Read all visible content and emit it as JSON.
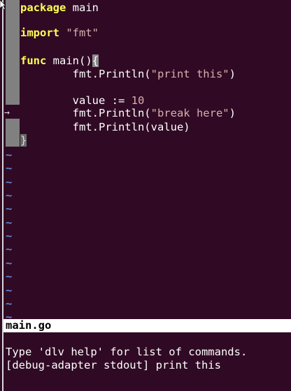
{
  "editor": {
    "lines": [
      {
        "kw": "package",
        "rest": " main"
      },
      {
        "empty": true
      },
      {
        "kw": "import",
        "space": " ",
        "str": "\"fmt\""
      },
      {
        "empty": true
      },
      {
        "kw": "func",
        "rest": " main()",
        "brace": "{"
      },
      {
        "indent": "        ",
        "pre": "fmt.Println(",
        "str": "\"print this\"",
        "post": ")"
      },
      {
        "empty": true
      },
      {
        "indent": "        ",
        "pre": "value := ",
        "num": "10"
      },
      {
        "indent": "        ",
        "pre": "fmt.Println(",
        "str": "\"break here\"",
        "post": ")"
      },
      {
        "indent": "        ",
        "pre": "fmt.Println(value)"
      },
      {
        "brace_close": "}"
      }
    ],
    "breakpoint_marker": "→",
    "tilde": "~"
  },
  "statusline": {
    "filename": "main.go"
  },
  "messages": [
    "Type 'dlv help' for list of commands.",
    "[debug-adapter stdout] print this"
  ],
  "colors": {
    "background": "#300a24",
    "keyword": "#ffff55",
    "string": "#d7afaf",
    "tilde": "#5f87d7",
    "sign_column": "#808080"
  }
}
